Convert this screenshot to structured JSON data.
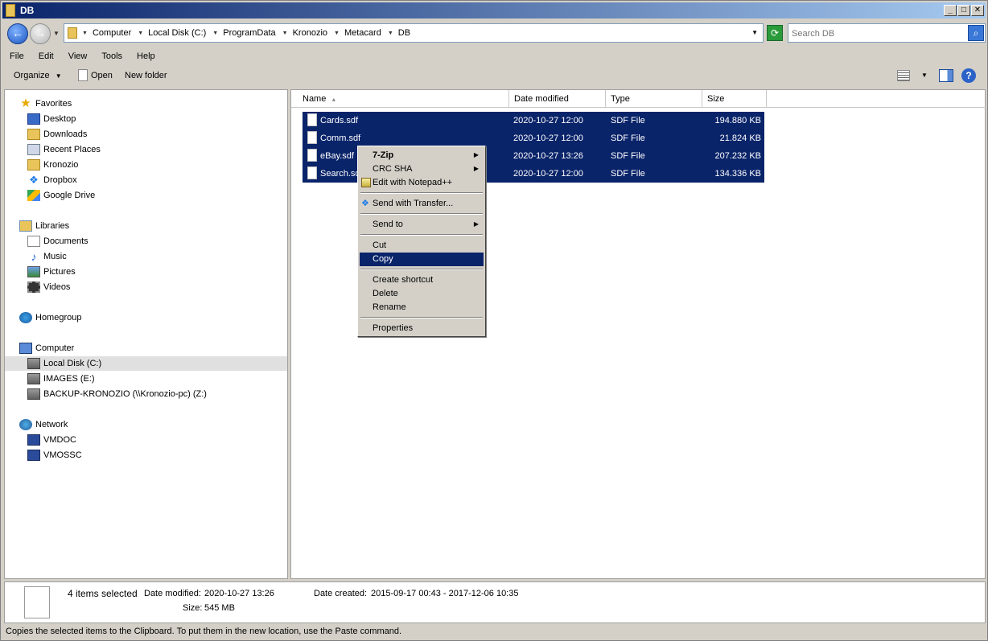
{
  "window": {
    "title": "DB"
  },
  "address": {
    "crumbs": [
      "Computer",
      "Local Disk (C:)",
      "ProgramData",
      "Kronozio",
      "Metacard",
      "DB"
    ],
    "search_placeholder": "Search DB"
  },
  "menu": [
    "File",
    "Edit",
    "View",
    "Tools",
    "Help"
  ],
  "toolbar": {
    "organize": "Organize",
    "open": "Open",
    "new_folder": "New folder"
  },
  "nav": {
    "favorites": "Favorites",
    "favorites_items": [
      "Desktop",
      "Downloads",
      "Recent Places",
      "Kronozio",
      "Dropbox",
      "Google Drive"
    ],
    "libraries": "Libraries",
    "libraries_items": [
      "Documents",
      "Music",
      "Pictures",
      "Videos"
    ],
    "homegroup": "Homegroup",
    "computer": "Computer",
    "computer_items": [
      "Local Disk (C:)",
      "IMAGES (E:)",
      "BACKUP-KRONOZIO (\\\\Kronozio-pc) (Z:)"
    ],
    "network": "Network",
    "network_items": [
      "VMDOC",
      "VMOSSC"
    ]
  },
  "columns": [
    "Name",
    "Date modified",
    "Type",
    "Size"
  ],
  "files": [
    {
      "name": "Cards.sdf",
      "date": "2020-10-27 12:00",
      "type": "SDF File",
      "size": "194.880 KB"
    },
    {
      "name": "Comm.sdf",
      "date": "2020-10-27 12:00",
      "type": "SDF File",
      "size": "21.824 KB"
    },
    {
      "name": "eBay.sdf",
      "date": "2020-10-27 13:26",
      "type": "SDF File",
      "size": "207.232 KB"
    },
    {
      "name": "Search.sdf",
      "date": "2020-10-27 12:00",
      "type": "SDF File",
      "size": "134.336 KB"
    }
  ],
  "context_menu": {
    "zip": "7-Zip",
    "crc": "CRC SHA",
    "notepad": "Edit with Notepad++",
    "transfer": "Send with Transfer...",
    "send_to": "Send to",
    "cut": "Cut",
    "copy": "Copy",
    "shortcut": "Create shortcut",
    "delete": "Delete",
    "rename": "Rename",
    "properties": "Properties"
  },
  "details": {
    "selected": "4 items selected",
    "date_modified_label": "Date modified:",
    "date_modified": "2020-10-27 13:26",
    "size_label": "Size:",
    "size": "545 MB",
    "date_created_label": "Date created:",
    "date_created": "2015-09-17 00:43 - 2017-12-06 10:35"
  },
  "status": "Copies the selected items to the Clipboard. To put them in the new location, use the Paste command."
}
